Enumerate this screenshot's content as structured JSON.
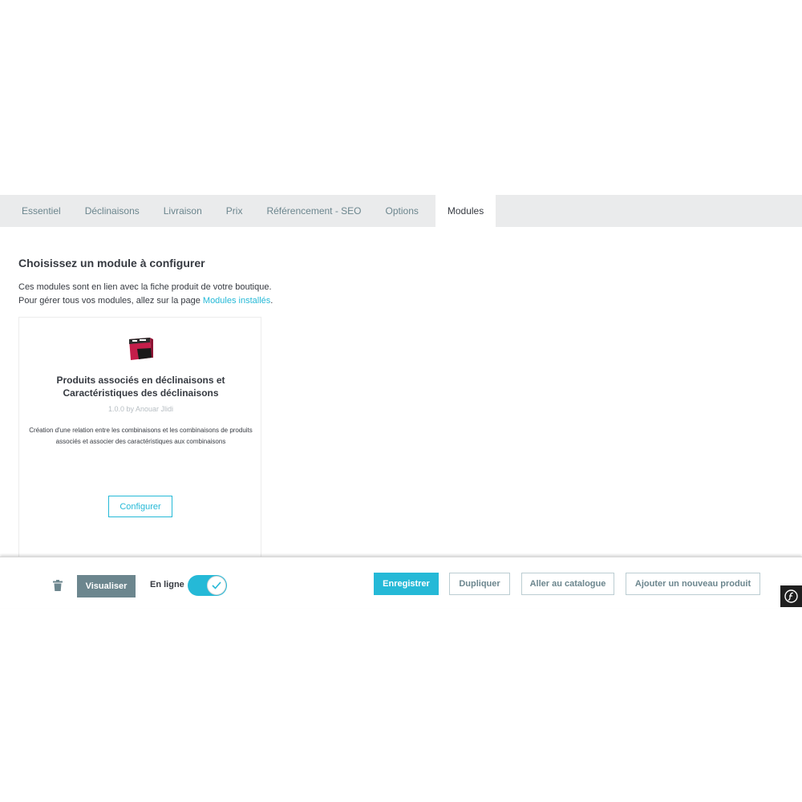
{
  "tabs": [
    {
      "label": "Essentiel"
    },
    {
      "label": "Déclinaisons"
    },
    {
      "label": "Livraison"
    },
    {
      "label": "Prix"
    },
    {
      "label": "Référencement - SEO"
    },
    {
      "label": "Options"
    },
    {
      "label": "Modules",
      "active": true
    }
  ],
  "panel": {
    "title": "Choisissez un module à configurer",
    "desc_line1": "Ces modules sont en lien avec la fiche produit de votre boutique.",
    "desc_line2_prefix": "Pour gérer tous vos modules, allez sur la page ",
    "desc_link": "Modules installés",
    "desc_line2_suffix": "."
  },
  "module": {
    "name": "Produits associés en déclinaisons et Caractéristiques des déclinaisons",
    "version": "1.0.0 by Anouar Jlidi",
    "description": "Création d'une relation entre les combinaisons et les combinaisons de produits associés et associer des caractéristiques aux combinaisons",
    "configure_label": "Configurer",
    "logo_icon": "module-box-icon"
  },
  "footer": {
    "preview_label": "Visualiser",
    "online_label": "En ligne",
    "online_enabled": true,
    "save_label": "Enregistrer",
    "duplicate_label": "Dupliquer",
    "catalog_label": "Aller au catalogue",
    "new_product_label": "Ajouter un nouveau produit"
  },
  "colors": {
    "accent": "#25b9d7",
    "preview_button": "#6c868e",
    "tabbar_bg": "#eaebec"
  }
}
